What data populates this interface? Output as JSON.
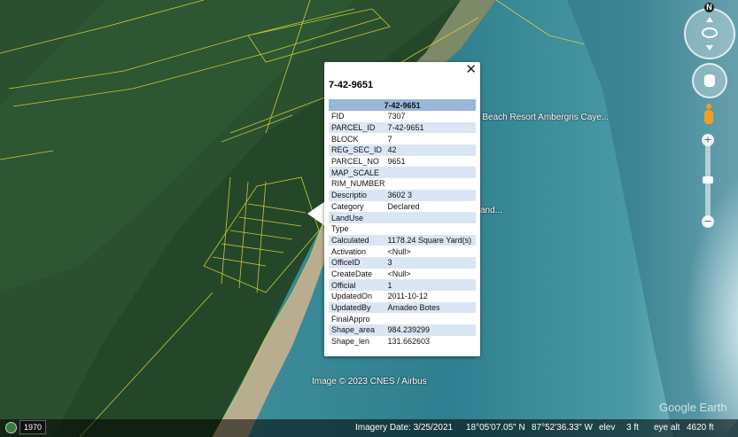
{
  "map": {
    "place_labels": [
      "e Beach Resort Ambergris Caye...",
      "and..."
    ]
  },
  "balloon": {
    "title": "7-42-9651",
    "close_glyph": "✕",
    "table_header": "7-42-9651",
    "attributes": [
      {
        "field": "FID",
        "value": "7307"
      },
      {
        "field": "PARCEL_ID",
        "value": "7-42-9651"
      },
      {
        "field": "BLOCK",
        "value": "7"
      },
      {
        "field": "REG_SEC_ID",
        "value": "42"
      },
      {
        "field": "PARCEL_NO",
        "value": "9651"
      },
      {
        "field": "MAP_SCALE",
        "value": ""
      },
      {
        "field": "RIM_NUMBER",
        "value": ""
      },
      {
        "field": "Descriptio",
        "value": "3602 3"
      },
      {
        "field": "Category",
        "value": "Declared"
      },
      {
        "field": "LandUse",
        "value": ""
      },
      {
        "field": "Type",
        "value": ""
      },
      {
        "field": "Calculated",
        "value": "1178.24 Square Yard(s)"
      },
      {
        "field": "Activation",
        "value": "<Null>"
      },
      {
        "field": "OfficeID",
        "value": "3"
      },
      {
        "field": "CreateDate",
        "value": "<Null>"
      },
      {
        "field": "Official",
        "value": "1"
      },
      {
        "field": "UpdatedOn",
        "value": "2011-10-12"
      },
      {
        "field": "UpdatedBy",
        "value": "Amadeo Botes"
      },
      {
        "field": "FinalAppro",
        "value": ""
      },
      {
        "field": "Shape_area",
        "value": "984.239299"
      },
      {
        "field": "Shape_len",
        "value": "131.662603"
      }
    ]
  },
  "nav": {
    "north_label": "N",
    "zoom_in": "+",
    "zoom_out": "−"
  },
  "credit": "Image © 2023 CNES / Airbus",
  "logo": "Google Earth",
  "status": {
    "year": "1970",
    "imagery_date": "Imagery Date: 3/25/2021",
    "latitude": "18°05'07.05\" N",
    "longitude": "87°52'36.33\" W",
    "elev_label": "elev",
    "elev_value": "3 ft",
    "eye_alt_label": "eye alt",
    "eye_alt_value": "4620 ft"
  },
  "colors": {
    "parcel_line": "#e8e030",
    "table_header_bg": "#98b6d8",
    "row_alt_bg": "#dbe6f4"
  }
}
